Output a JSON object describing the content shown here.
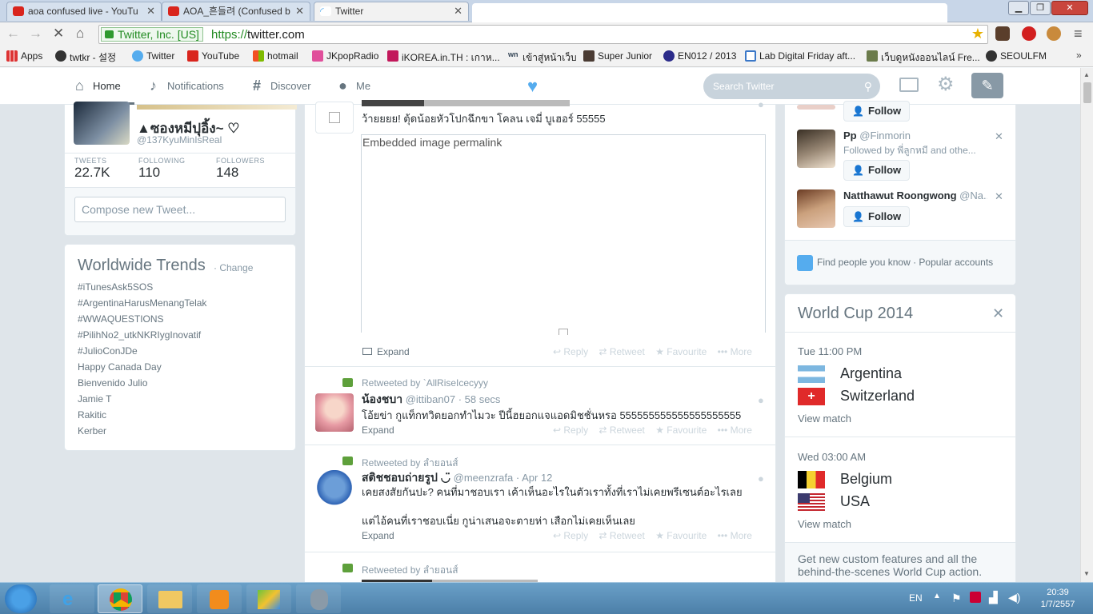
{
  "browser": {
    "tabs": [
      {
        "title": "aoa confused live - YouTu",
        "active": false
      },
      {
        "title": "AOA_흔들려 (Confused b",
        "active": false
      },
      {
        "title": "Twitter",
        "active": true
      }
    ],
    "identity": "Twitter, Inc. [US]",
    "url_scheme": "https://",
    "url_host": "twitter.com",
    "bookmarks": [
      "Apps",
      "twtkr - 설정",
      "Twitter",
      "YouTube",
      "hotmail",
      "JKpopRadio",
      "iKOREA.in.TH : เกาห...",
      "เข้าสู่หน้าเว็บ",
      "Super Junior",
      "EN012 / 2013",
      "Lab Digital Friday aft...",
      "เว็บดูหนังออนไลน์ Fre...",
      "SEOULFM"
    ]
  },
  "nav": {
    "items": [
      "Home",
      "Notifications",
      "Discover",
      "Me"
    ],
    "search_placeholder": "Search Twitter"
  },
  "profile": {
    "name": "▲ซองหมีปุอิ้ง~ ♡",
    "handle": "@137KyuMinIsReal",
    "stats": [
      {
        "label": "TWEETS",
        "value": "22.7K"
      },
      {
        "label": "FOLLOWING",
        "value": "110"
      },
      {
        "label": "FOLLOWERS",
        "value": "148"
      }
    ],
    "compose_placeholder": "Compose new Tweet..."
  },
  "trends": {
    "title": "Worldwide Trends",
    "change": "· Change",
    "items": [
      "#iTunesAsk5SOS",
      "#ArgentinaHarusMenangTelak",
      "#WWAQUESTIONS",
      "#PilihNo2_utkNKRIygInovatif",
      "#JulioConJDe",
      "Happy Canada Day",
      "Bienvenido Julio",
      "Jamie T",
      "Rakitic",
      "Kerber"
    ]
  },
  "timeline": {
    "tweets": [
      {
        "text": "ว้ายยยย! ตุ้ดน้อยหัวโปกฉึกขา โคลน เจมี่ บูเฮอร์ 55555",
        "embedded_label": "Embedded image permalink",
        "expand": "Expand"
      },
      {
        "retweeted_by": "Retweeted by `AllRiseIcecyyy",
        "name": "น้องชบา",
        "handle": "@ittiban07",
        "time": "· 58 secs",
        "text": "โอ้ยข่า กูแท็กทวิตยอกทำไมวะ ปีนี้ฮยอกแจแอดมิชชั่นหรอ 555555555555555555555",
        "expand": "Expand"
      },
      {
        "retweeted_by": "Retweeted by ลำยอนส์",
        "name": "สติชชอบถ่ายรูป ◡̈",
        "handle": "@meenzrafa",
        "time": "· Apr 12",
        "text": "เคยสงสัยกันปะ? คนที่มาชอบเรา เค้าเห็นอะไรในตัวเราทั้งที่เราไม่เคยพรีเซนต์อะไรเลย",
        "text2": "แต่ไอ้คนที่เราชอบเนี่ย กูน่าเสนอจะตายห่า เสือกไม่เคยเห็นเลย",
        "expand": "Expand"
      },
      {
        "retweeted_by": "Retweeted by ลำยอนส์"
      }
    ],
    "actions": [
      "Reply",
      "Retweet",
      "Favourite",
      "More"
    ]
  },
  "who_to_follow": {
    "follow_label": "Follow",
    "people": [
      {
        "name": "Pp",
        "handle": "@Finmorin",
        "followed_by": "Followed by พี่ลูกหมี and othe..."
      },
      {
        "name": "Natthawut Roongwong",
        "handle": "@Na..."
      }
    ],
    "find_people": "Find people you know",
    "popular": "· Popular accounts"
  },
  "worldcup": {
    "title": "World Cup 2014",
    "matches": [
      {
        "time": "Tue 11:00 PM",
        "team1": "Argentina",
        "team2": "Switzerland",
        "view": "View match"
      },
      {
        "time": "Wed 03:00 AM",
        "team1": "Belgium",
        "team2": "USA",
        "view": "View match"
      }
    ],
    "promo": "Get new custom features and all the behind-the-scenes World Cup action."
  },
  "taskbar": {
    "lang": "EN",
    "time": "20:39",
    "date": "1/7/2557"
  }
}
